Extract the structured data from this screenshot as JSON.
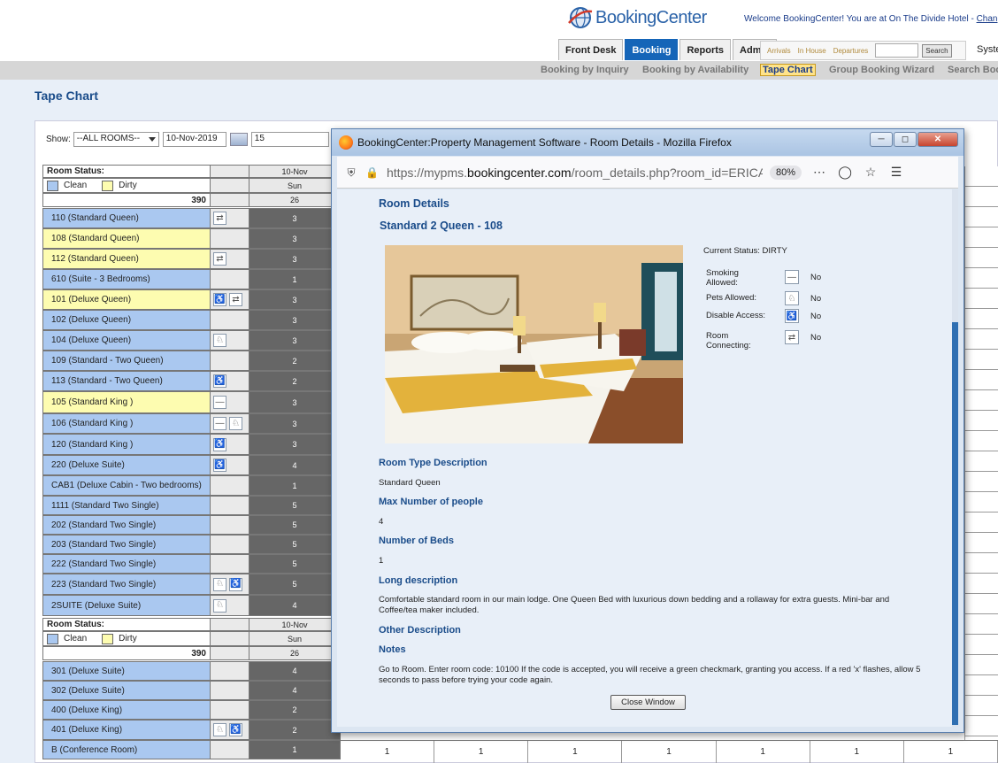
{
  "header": {
    "logo_text": "BookingCenter",
    "welcome_text": "Welcome BookingCenter! You are at On The Divide Hotel - ",
    "change_link": "Change"
  },
  "main_tabs": [
    {
      "label": "Front Desk",
      "active": false
    },
    {
      "label": "Booking",
      "active": true
    },
    {
      "label": "Reports",
      "active": false
    },
    {
      "label": "Admin",
      "active": false
    }
  ],
  "quick_search": {
    "links": [
      "Arrivals",
      "In House",
      "Departures"
    ],
    "search_label": "Search",
    "system_cut": "Syste"
  },
  "subnav": [
    "Booking by Inquiry",
    "Booking by Availability",
    "Tape Chart",
    "Group Booking Wizard",
    "Search Boo"
  ],
  "page": {
    "title": "Tape Chart",
    "show_label": "Show:",
    "show_value": "--ALL ROOMS--",
    "date_value": "10-Nov-2019",
    "days_value": "15"
  },
  "tape": {
    "status_label": "Room Status:",
    "clean_label": "Clean",
    "dirty_label": "Dirty",
    "date_header": "10-Nov",
    "day_header": "Sun",
    "total_rooms": "390",
    "total_avail": "26",
    "rooms": [
      {
        "name": "110 (Standard Queen)",
        "status": "clean",
        "count": "3",
        "icons": [
          "connecting-icon"
        ]
      },
      {
        "name": "108 (Standard Queen)",
        "status": "dirty",
        "count": "3",
        "icons": []
      },
      {
        "name": "112 (Standard Queen)",
        "status": "dirty",
        "count": "3",
        "icons": [
          "connecting-icon"
        ]
      },
      {
        "name": "610 (Suite - 3 Bedrooms)",
        "status": "clean",
        "count": "1",
        "icons": []
      },
      {
        "name": "101 (Deluxe Queen)",
        "status": "dirty",
        "count": "3",
        "icons": [
          "wheelchair-icon",
          "connecting-icon"
        ]
      },
      {
        "name": "102 (Deluxe Queen)",
        "status": "clean",
        "count": "3",
        "icons": []
      },
      {
        "name": "104 (Deluxe Queen)",
        "status": "clean",
        "count": "3",
        "icons": [
          "pet-icon"
        ]
      },
      {
        "name": "109 (Standard - Two Queen)",
        "status": "clean",
        "count": "2",
        "icons": []
      },
      {
        "name": "113 (Standard - Two Queen)",
        "status": "clean",
        "count": "2",
        "icons": [
          "wheelchair-icon"
        ]
      },
      {
        "name": "105 (Standard King )",
        "status": "dirty",
        "count": "3",
        "icons": [
          "smoking-icon"
        ]
      },
      {
        "name": "106 (Standard King )",
        "status": "clean",
        "count": "3",
        "icons": [
          "smoking-icon",
          "pet-icon"
        ]
      },
      {
        "name": "120 (Standard King )",
        "status": "clean",
        "count": "3",
        "icons": [
          "wheelchair-icon"
        ]
      },
      {
        "name": "220 (Deluxe Suite)",
        "status": "clean",
        "count": "4",
        "icons": [
          "wheelchair-icon"
        ]
      },
      {
        "name": "CAB1 (Deluxe Cabin - Two bedrooms)",
        "status": "clean",
        "count": "1",
        "icons": []
      },
      {
        "name": "1111 (Standard Two Single)",
        "status": "clean",
        "count": "5",
        "icons": []
      },
      {
        "name": "202 (Standard Two Single)",
        "status": "clean",
        "count": "5",
        "icons": []
      },
      {
        "name": "203 (Standard Two Single)",
        "status": "clean",
        "count": "5",
        "icons": []
      },
      {
        "name": "222 (Standard Two Single)",
        "status": "clean",
        "count": "5",
        "icons": []
      },
      {
        "name": "223 (Standard Two Single)",
        "status": "clean",
        "count": "5",
        "icons": [
          "pet-icon",
          "wheelchair-icon"
        ]
      },
      {
        "name": "2SUITE (Deluxe Suite)",
        "status": "clean",
        "count": "4",
        "icons": [
          "pet-icon"
        ]
      }
    ],
    "rooms2": [
      {
        "name": "301 (Deluxe Suite)",
        "status": "clean",
        "count": "4",
        "icons": []
      },
      {
        "name": "302 (Deluxe Suite)",
        "status": "clean",
        "count": "4",
        "icons": []
      },
      {
        "name": "400 (Deluxe King)",
        "status": "clean",
        "count": "2",
        "icons": []
      },
      {
        "name": "401 (Deluxe King)",
        "status": "clean",
        "count": "2",
        "icons": [
          "pet-icon",
          "wheelchair-icon"
        ]
      },
      {
        "name": "B (Conference Room)",
        "status": "clean",
        "count": "1",
        "icons": []
      }
    ],
    "bottom_cells": [
      "1",
      "1",
      "1",
      "1",
      "1",
      "1",
      "1"
    ]
  },
  "popup": {
    "window_title": "BookingCenter:Property Management Software - Room Details - Mozilla Firefox",
    "url_prefix": "https://mypms.",
    "url_domain": "bookingcenter.com",
    "url_path": "/room_details.php?room_id=ERICA",
    "zoom": "80%",
    "heading": "Room Details",
    "room_title": "Standard 2 Queen - 108",
    "current_status": "Current Status: DIRTY",
    "attributes": [
      {
        "label_lines": [
          "Smoking",
          "Allowed:"
        ],
        "icon": "smoking-icon",
        "value": "No"
      },
      {
        "label_lines": [
          "Pets Allowed:"
        ],
        "icon": "pet-icon",
        "value": "No"
      },
      {
        "label_lines": [
          "Disable Access:"
        ],
        "icon": "wheelchair-icon",
        "value": "No"
      },
      {
        "label_lines": [
          "Room",
          "Connecting:"
        ],
        "icon": "connecting-icon",
        "value": "No"
      }
    ],
    "room_type_label": "Room Type Description",
    "room_type_value": "Standard Queen",
    "max_people_label": "Max Number of people",
    "max_people_value": "4",
    "beds_label": "Number of Beds",
    "beds_value": "1",
    "long_desc_label": "Long description",
    "long_desc_value": "Comfortable standard room in our main lodge. One Queen Bed with luxurious down bedding and a rollaway for extra guests. Mini-bar and Coffee/tea maker included.",
    "other_desc_label": "Other Description",
    "notes_label": "Notes",
    "notes_value": "Go to Room. Enter room code: 10100 If the code is accepted, you will receive a green checkmark, granting you access. If a red 'x' flashes, allow 5 seconds to pass before trying your code again.",
    "close_button": "Close Window"
  }
}
